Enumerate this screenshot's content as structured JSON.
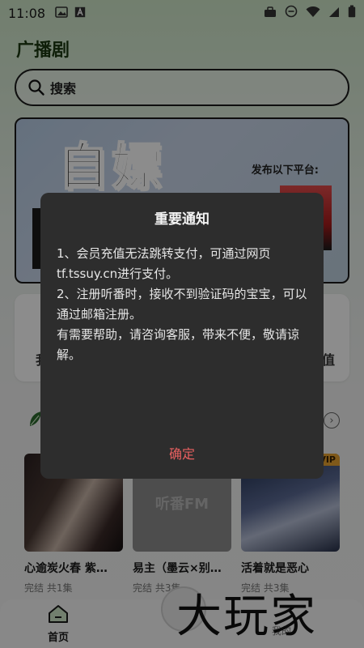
{
  "status_bar": {
    "time": "11:08",
    "left_icons": [
      "image-icon",
      "text-a-icon"
    ],
    "right_icons": [
      "briefcase-icon",
      "dnd-icon",
      "wifi-icon",
      "signal-icon",
      "battery-icon"
    ]
  },
  "page": {
    "title": "广播剧",
    "search": {
      "placeholder": "搜索"
    }
  },
  "banner": {
    "headline": "自嫖",
    "platform_note": "发布以下平台:"
  },
  "features_row": {
    "left_edge_char": "我",
    "right_edge_char": "值"
  },
  "cards": [
    {
      "name": "心逾炭火春 紫…",
      "meta": "完结 共1集"
    },
    {
      "name": "易主（墨云×别…",
      "meta": "完结 共3集",
      "cover_text": "听番FM"
    },
    {
      "name": "活着就是恶心",
      "meta": "完结 共3集",
      "tag": "VIP"
    }
  ],
  "tabbar": {
    "home_label": "首页",
    "mine_label": "我的"
  },
  "watermark": "大玩家",
  "dialog": {
    "title": "重要通知",
    "lines": [
      "1、会员充值无法跳转支付，可通过网页tf.tssuy.cn进行支付。",
      "2、注册听番时，接收不到验证码的宝宝，可以通过邮箱注册。",
      "有需要帮助，请咨询客服，带来不便，敬请谅解。"
    ],
    "confirm_label": "确定"
  },
  "colors": {
    "dialog_bg": "#2d2d2d",
    "confirm_text": "#e86060",
    "vip_tag": "#e8a330"
  }
}
